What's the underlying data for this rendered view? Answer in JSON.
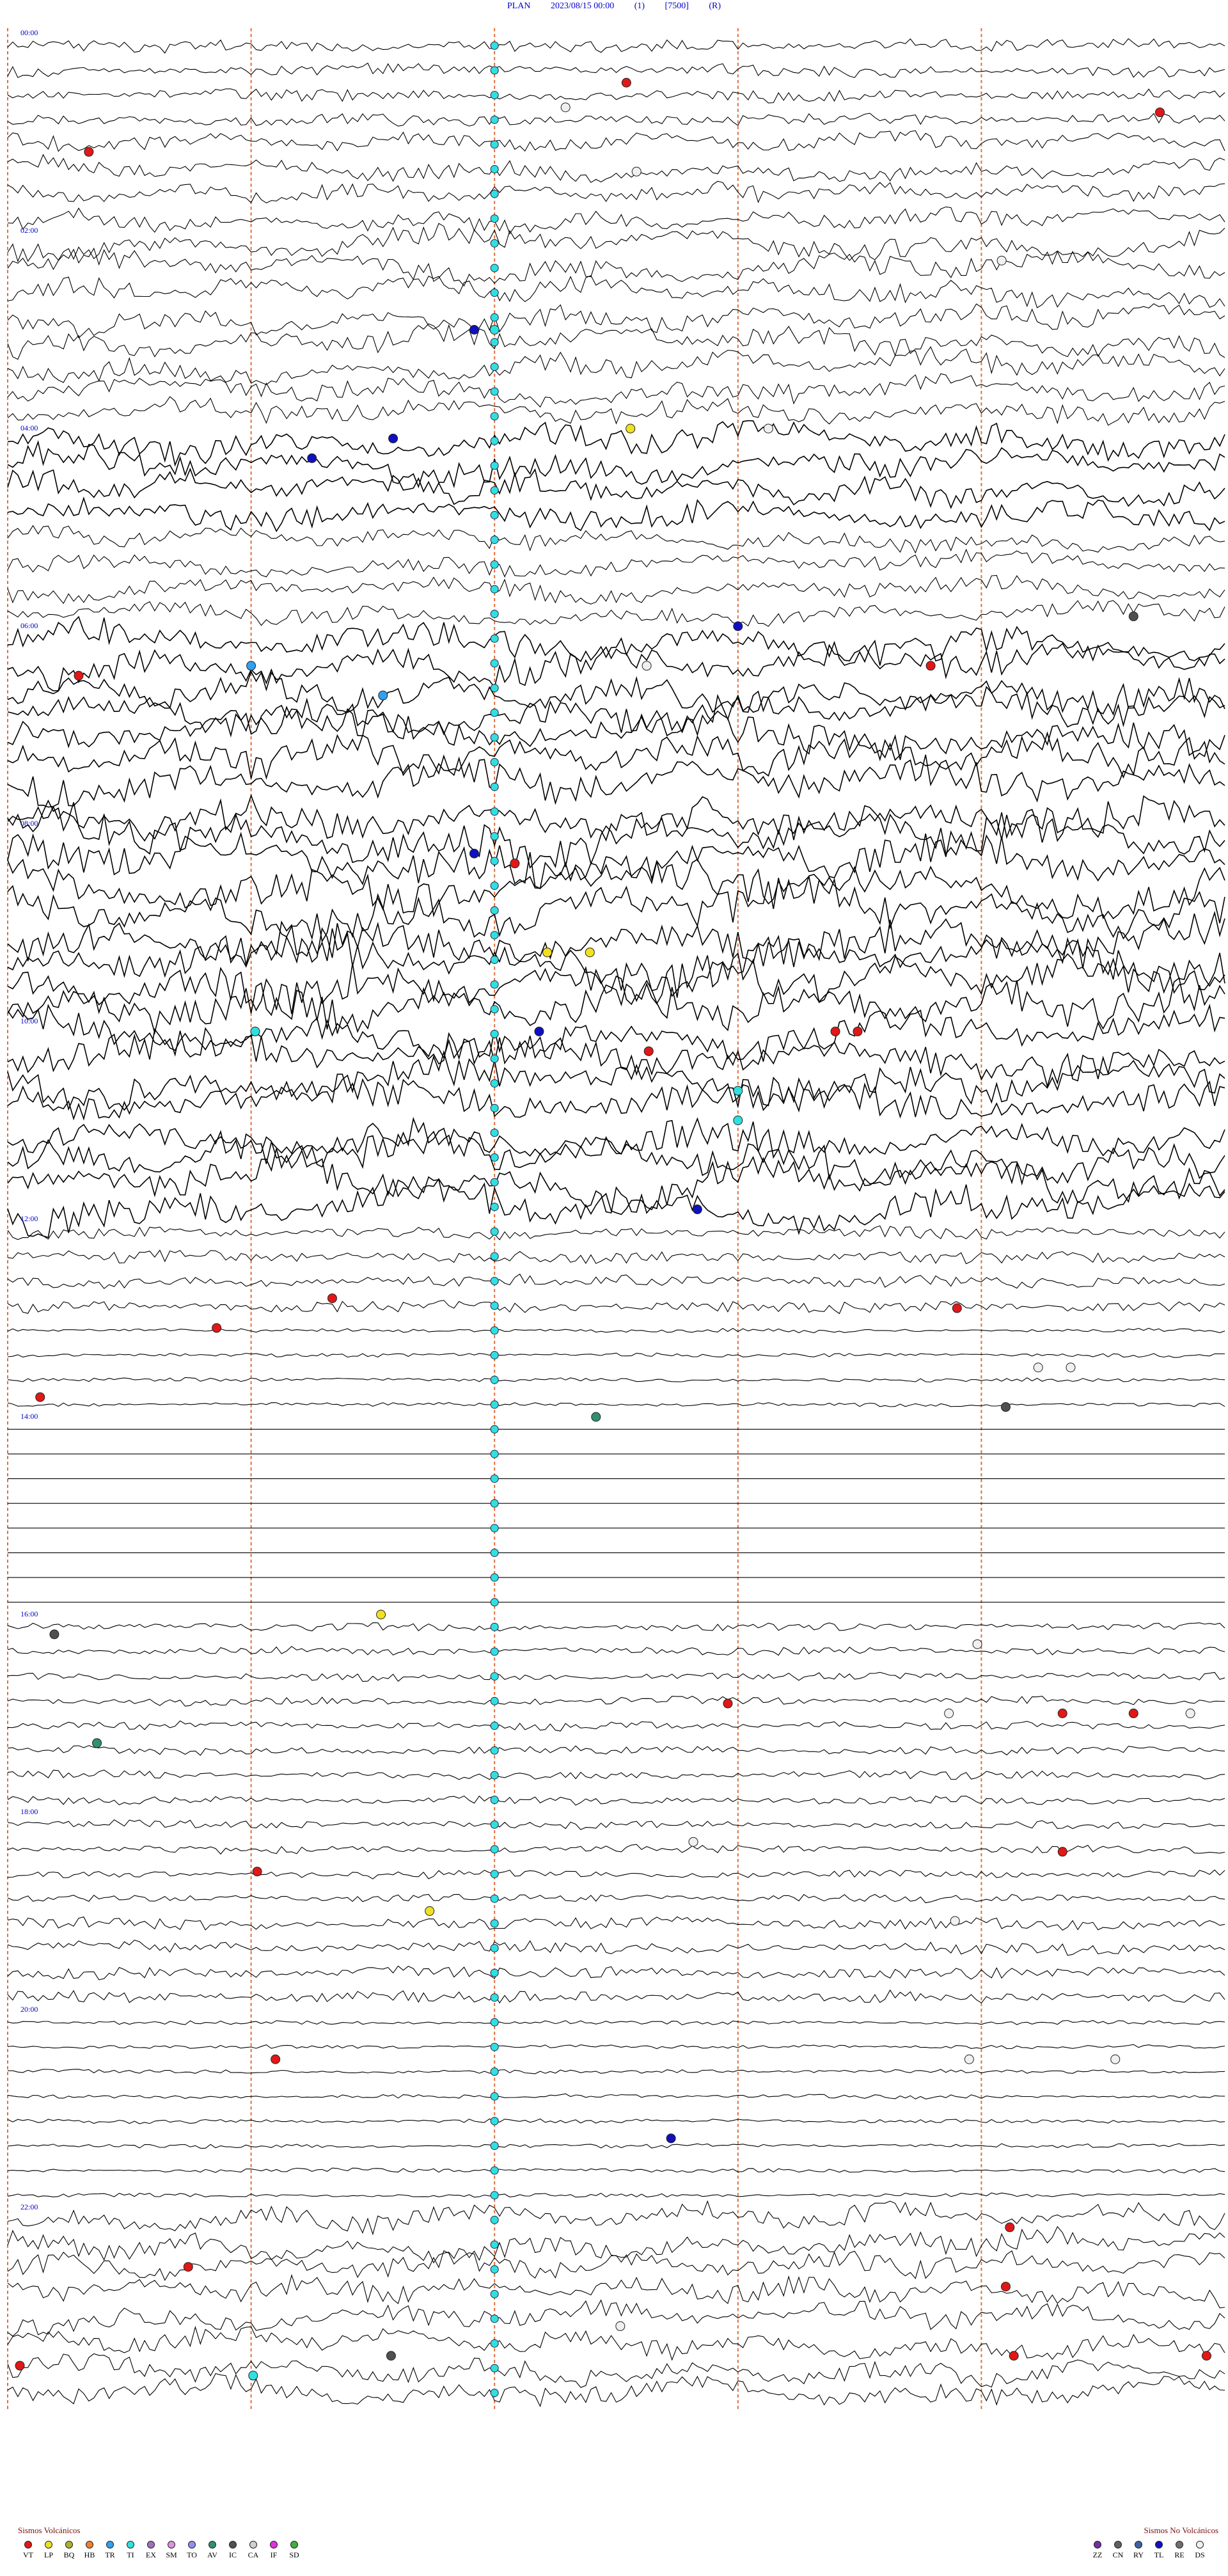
{
  "header": {
    "station": "PLAN",
    "datetime": "2023/08/15 00:00",
    "channel": "(1)",
    "scale": "[7500]",
    "component": "(R)"
  },
  "colors": {
    "trace": "#000000",
    "title": "#0000cc",
    "time_label": "#0000cc",
    "minute_marker": "#e07040"
  },
  "chart_data": {
    "type": "scatter",
    "title": "PLAN 2023/08/15 00:00 (1) [7500] (R)",
    "xlabel": "",
    "ylabel": "",
    "rows_per_hour": 4,
    "hours": 24,
    "hour_labels": [
      "00:00",
      "02:00",
      "04:00",
      "06:00",
      "08:00",
      "10:00",
      "12:00",
      "14:00",
      "16:00",
      "18:00",
      "20:00",
      "22:00"
    ],
    "minute_markers": [
      0,
      12,
      24,
      36,
      48
    ],
    "activity_by_hour": [
      3,
      4,
      5,
      5,
      6,
      4,
      7,
      8,
      9,
      9,
      8,
      8,
      3,
      1,
      0,
      0,
      2,
      2,
      2,
      3,
      1,
      1,
      5,
      5
    ],
    "events": [
      {
        "type": "VT",
        "hour": 0.5,
        "minute": 30.5
      },
      {
        "type": "DS",
        "hour": 0.75,
        "minute": 27.5
      },
      {
        "type": "VT",
        "hour": 0.8,
        "minute": 56.8
      },
      {
        "type": "VT",
        "hour": 1.2,
        "minute": 4
      },
      {
        "type": "DS",
        "hour": 1.4,
        "minute": 31
      },
      {
        "type": "DS",
        "hour": 2.3,
        "minute": 49
      },
      {
        "type": "TI",
        "hour": 3.0,
        "minute": 24
      },
      {
        "type": "TL",
        "hour": 3.0,
        "minute": 23
      },
      {
        "type": "LP",
        "hour": 4.0,
        "minute": 30.7
      },
      {
        "type": "TL",
        "hour": 4.1,
        "minute": 19
      },
      {
        "type": "TL",
        "hour": 4.3,
        "minute": 15
      },
      {
        "type": "DS",
        "hour": 4.0,
        "minute": 37.5
      },
      {
        "type": "IC",
        "hour": 5.9,
        "minute": 55.5
      },
      {
        "type": "TL",
        "hour": 6.0,
        "minute": 36
      },
      {
        "type": "VT",
        "hour": 6.5,
        "minute": 3.5
      },
      {
        "type": "TR",
        "hour": 6.4,
        "minute": 12
      },
      {
        "type": "DS",
        "hour": 6.4,
        "minute": 31.5
      },
      {
        "type": "VT",
        "hour": 6.4,
        "minute": 45.5
      },
      {
        "type": "TR",
        "hour": 6.7,
        "minute": 18.5
      },
      {
        "type": "TL",
        "hour": 8.3,
        "minute": 23
      },
      {
        "type": "VT",
        "hour": 8.4,
        "minute": 25
      },
      {
        "type": "LP",
        "hour": 9.3,
        "minute": 26.6
      },
      {
        "type": "LP",
        "hour": 9.3,
        "minute": 28.7
      },
      {
        "type": "TI",
        "hour": 10.1,
        "minute": 12.2
      },
      {
        "type": "TL",
        "hour": 10.1,
        "minute": 26.2
      },
      {
        "type": "VT",
        "hour": 10.1,
        "minute": 40.8
      },
      {
        "type": "VT",
        "hour": 10.1,
        "minute": 41.9
      },
      {
        "type": "VT",
        "hour": 10.3,
        "minute": 31.6
      },
      {
        "type": "TI",
        "hour": 10.7,
        "minute": 36
      },
      {
        "type": "TI",
        "hour": 11.0,
        "minute": 36
      },
      {
        "type": "TL",
        "hour": 11.9,
        "minute": 34
      },
      {
        "type": "VT",
        "hour": 12.8,
        "minute": 16
      },
      {
        "type": "VT",
        "hour": 12.9,
        "minute": 46.8
      },
      {
        "type": "VT",
        "hour": 13.1,
        "minute": 10.3
      },
      {
        "type": "DS",
        "hour": 13.5,
        "minute": 50.8
      },
      {
        "type": "DS",
        "hour": 13.5,
        "minute": 52.4
      },
      {
        "type": "VT",
        "hour": 13.8,
        "minute": 1.6
      },
      {
        "type": "AV",
        "hour": 14.0,
        "minute": 29
      },
      {
        "type": "IC",
        "hour": 13.9,
        "minute": 49.2
      },
      {
        "type": "LP",
        "hour": 16.0,
        "minute": 18.4
      },
      {
        "type": "IC",
        "hour": 16.2,
        "minute": 2.3
      },
      {
        "type": "DS",
        "hour": 16.3,
        "minute": 47.8
      },
      {
        "type": "VT",
        "hour": 16.9,
        "minute": 35.5
      },
      {
        "type": "DS",
        "hour": 17.0,
        "minute": 46.4
      },
      {
        "type": "VT",
        "hour": 17.0,
        "minute": 52
      },
      {
        "type": "VT",
        "hour": 17.0,
        "minute": 55.5
      },
      {
        "type": "DS",
        "hour": 17.0,
        "minute": 58.3
      },
      {
        "type": "AV",
        "hour": 17.3,
        "minute": 4.4
      },
      {
        "type": "VT",
        "hour": 18.6,
        "minute": 12.3
      },
      {
        "type": "DS",
        "hour": 18.3,
        "minute": 33.8
      },
      {
        "type": "VT",
        "hour": 18.4,
        "minute": 52
      },
      {
        "type": "LP",
        "hour": 19.0,
        "minute": 20.8
      },
      {
        "type": "DS",
        "hour": 19.1,
        "minute": 46.7
      },
      {
        "type": "VT",
        "hour": 20.5,
        "minute": 13.2
      },
      {
        "type": "DS",
        "hour": 20.5,
        "minute": 47.4
      },
      {
        "type": "DS",
        "hour": 20.5,
        "minute": 54.6
      },
      {
        "type": "TL",
        "hour": 21.3,
        "minute": 32.7
      },
      {
        "type": "VT",
        "hour": 22.2,
        "minute": 49.4
      },
      {
        "type": "VT",
        "hour": 22.6,
        "minute": 8.9
      },
      {
        "type": "VT",
        "hour": 22.8,
        "minute": 49.2
      },
      {
        "type": "DS",
        "hour": 23.2,
        "minute": 30.2
      },
      {
        "type": "IC",
        "hour": 23.5,
        "minute": 18.9
      },
      {
        "type": "VT",
        "hour": 23.6,
        "minute": 0.6
      },
      {
        "type": "VT",
        "hour": 23.5,
        "minute": 49.6
      },
      {
        "type": "VT",
        "hour": 23.5,
        "minute": 59.1
      },
      {
        "type": "TI",
        "hour": 23.7,
        "minute": 12.1
      }
    ],
    "ti_column_minute": 24,
    "ti_column_rows": 96
  },
  "legend": {
    "volcanic_title": "Sismos Volcánicos",
    "volcanic": [
      {
        "code": "VT",
        "color": "#e01818"
      },
      {
        "code": "LP",
        "color": "#f0e020"
      },
      {
        "code": "BQ",
        "color": "#b0b030"
      },
      {
        "code": "HB",
        "color": "#f08030"
      },
      {
        "code": "TR",
        "color": "#30a0f0"
      },
      {
        "code": "TI",
        "color": "#30e0e0"
      },
      {
        "code": "EX",
        "color": "#a070c0"
      },
      {
        "code": "SM",
        "color": "#e090e0"
      },
      {
        "code": "TO",
        "color": "#9090f0"
      },
      {
        "code": "AV",
        "color": "#309070"
      },
      {
        "code": "IC",
        "color": "#505050"
      },
      {
        "code": "CA",
        "color": "#d0d0d0"
      },
      {
        "code": "IF",
        "color": "#e030e0"
      },
      {
        "code": "SD",
        "color": "#40b040"
      }
    ],
    "nonvolcanic_title": "Sismos No Volcánicos",
    "nonvolcanic": [
      {
        "code": "ZZ",
        "color": "#7030a0"
      },
      {
        "code": "CN",
        "color": "#606060"
      },
      {
        "code": "RY",
        "color": "#4060a0"
      },
      {
        "code": "TL",
        "color": "#1010c0"
      },
      {
        "code": "RE",
        "color": "#707070"
      },
      {
        "code": "DS",
        "color": "#f0f0f0"
      }
    ]
  }
}
